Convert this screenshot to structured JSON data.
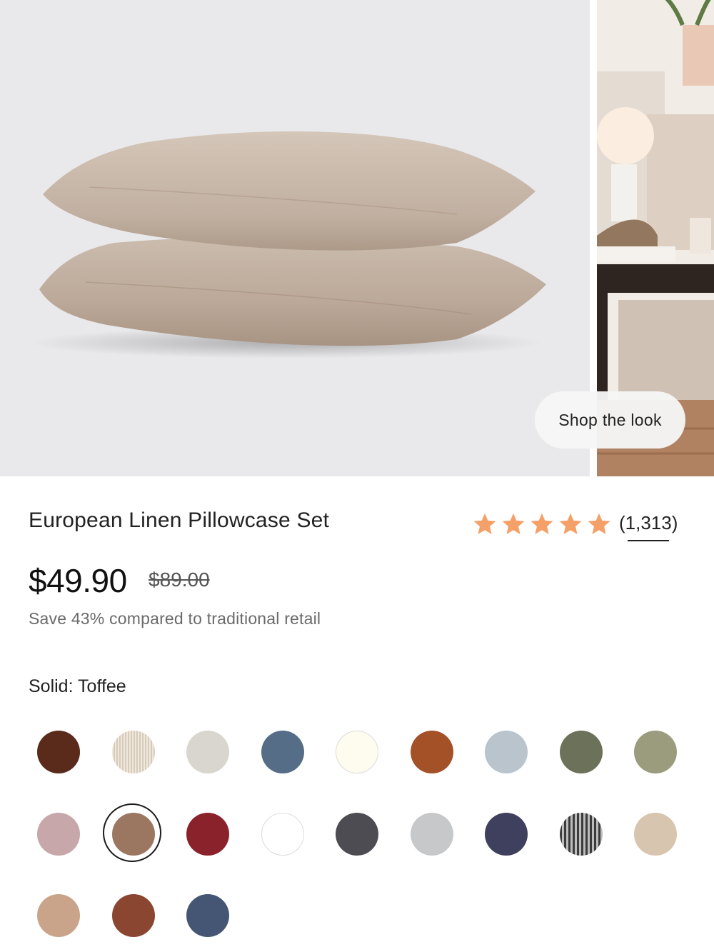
{
  "product": {
    "title": "European Linen Pillowcase Set",
    "rating": 5,
    "review_count": "(1,313)",
    "price": "$49.90",
    "compare_at_price": "$89.00",
    "savings_text": "Save 43% compared to traditional retail",
    "shop_the_look": "Shop the look"
  },
  "color": {
    "label_key": "Solid:",
    "label_value": "Toffee",
    "selected_index": 10,
    "swatches": [
      {
        "hex": "#5a2a1a"
      },
      {
        "hex": "#e8dccb",
        "pattern": "lines"
      },
      {
        "hex": "#d9d6cf"
      },
      {
        "hex": "#556d86"
      },
      {
        "hex": "#fdfcee",
        "outlined": true
      },
      {
        "hex": "#a45128"
      },
      {
        "hex": "#b9c4cc"
      },
      {
        "hex": "#6b7259"
      },
      {
        "hex": "#9b9c7d"
      },
      {
        "hex": "#c7a7a9"
      },
      {
        "hex": "#9b7762"
      },
      {
        "hex": "#8a222c"
      },
      {
        "hex": "#ffffff",
        "outlined": true
      },
      {
        "hex": "#4d4c53"
      },
      {
        "hex": "#c6c8ca"
      },
      {
        "hex": "#3f3f5e"
      },
      {
        "hex": "#6f6f6f",
        "pattern": "stripes"
      },
      {
        "hex": "#d8c5af"
      },
      {
        "hex": "#caa48a"
      },
      {
        "hex": "#8b4631"
      },
      {
        "hex": "#445674"
      }
    ]
  },
  "colors": {
    "star": "#f5a068",
    "text": "#222222",
    "muted": "#6a6a6a"
  }
}
